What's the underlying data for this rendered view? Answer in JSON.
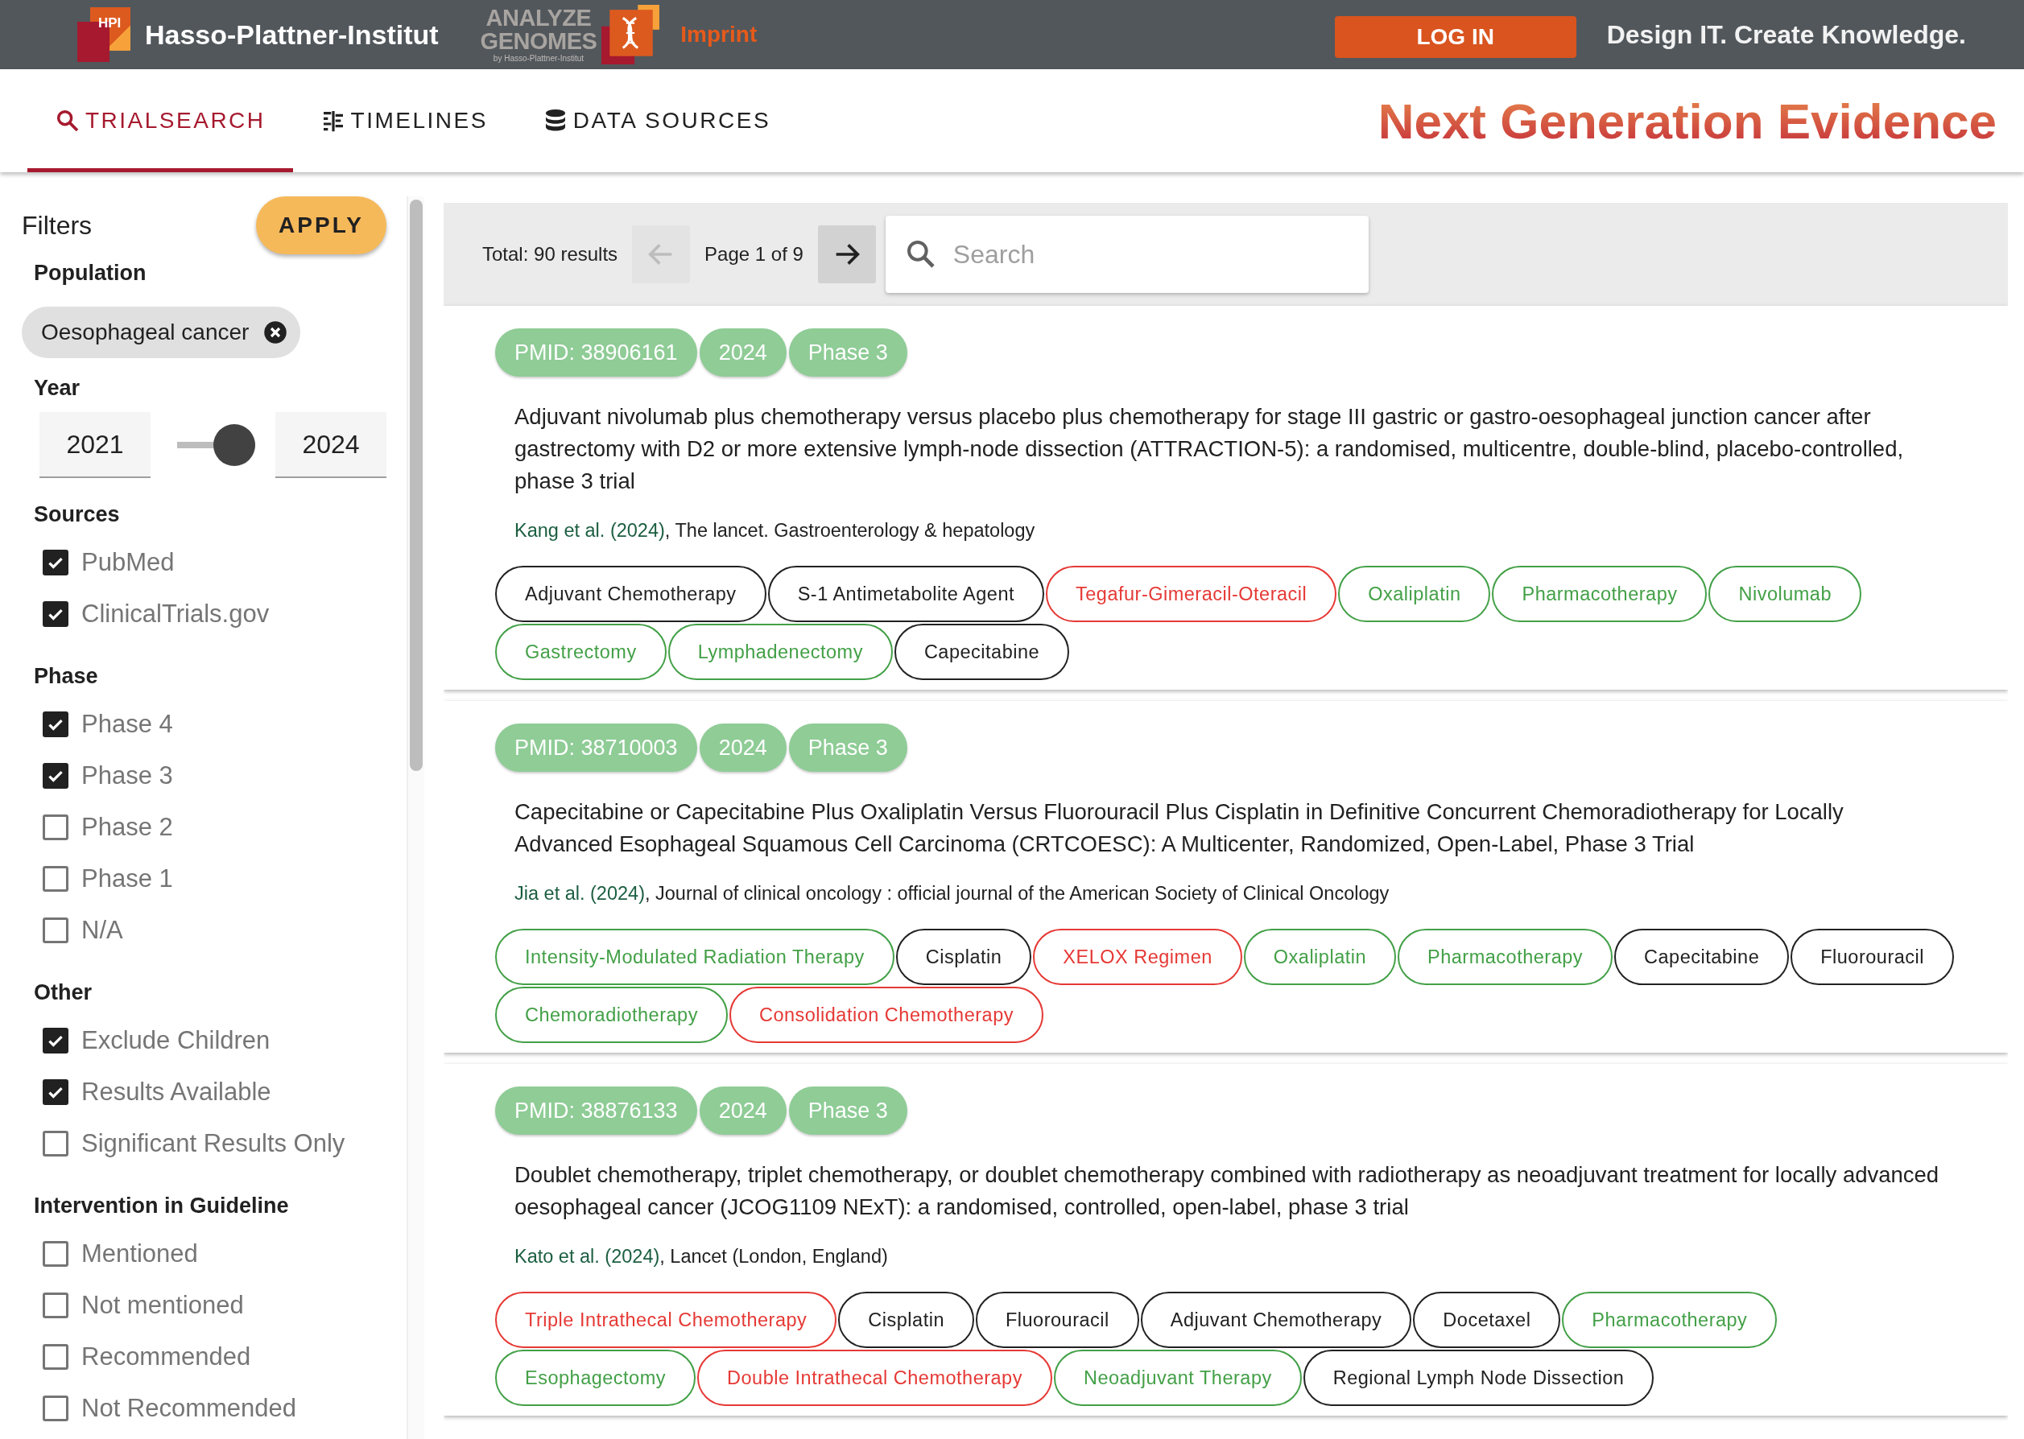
{
  "header": {
    "hpi_logo": "HPI",
    "institute": "Hasso-Plattner-Institut",
    "product_logo": {
      "line1": "ANALYZE",
      "line2": "GENOMES",
      "byline": "by Hasso-Plattner-Institut"
    },
    "imprint": "Imprint",
    "login": "LOG IN",
    "tagline": "Design IT. Create Knowledge."
  },
  "tabs": [
    {
      "label": "TRIALSEARCH",
      "kind": "search",
      "selected": true
    },
    {
      "label": "TIMELINES",
      "kind": "timeline",
      "selected": false
    },
    {
      "label": "DATA SOURCES",
      "kind": "database",
      "selected": false
    }
  ],
  "page_title": "Next Generation Evidence",
  "filters": {
    "title": "Filters",
    "apply": "APPLY",
    "population": {
      "label": "Population",
      "chips": [
        "Oesophageal cancer"
      ]
    },
    "year": {
      "label": "Year",
      "from": "2021",
      "to": "2024",
      "level": 1
    },
    "groups": [
      {
        "label": "Sources",
        "options": [
          {
            "label": "PubMed",
            "checked": true
          },
          {
            "label": "ClinicalTrials.gov",
            "checked": true
          }
        ]
      },
      {
        "label": "Phase",
        "options": [
          {
            "label": "Phase 4",
            "checked": true
          },
          {
            "label": "Phase 3",
            "checked": true
          },
          {
            "label": "Phase 2",
            "checked": false
          },
          {
            "label": "Phase 1",
            "checked": false
          },
          {
            "label": "N/A",
            "checked": false
          }
        ]
      },
      {
        "label": "Other",
        "options": [
          {
            "label": "Exclude Children",
            "checked": true
          },
          {
            "label": "Results Available",
            "checked": true
          },
          {
            "label": "Significant Results Only",
            "checked": false
          }
        ]
      },
      {
        "label": "Intervention in Guideline",
        "options": [
          {
            "label": "Mentioned",
            "checked": false
          },
          {
            "label": "Not mentioned",
            "checked": false
          },
          {
            "label": "Recommended",
            "checked": false
          },
          {
            "label": "Not Recommended",
            "checked": false
          }
        ]
      }
    ]
  },
  "results": {
    "total": "Total: 90 results",
    "prev": {
      "disabled": true
    },
    "page": "Page 1 of 9",
    "next": {
      "disabled": false
    },
    "search_placeholder": "Search",
    "items": [
      {
        "pmid": "PMID: 38906161",
        "year": "2024",
        "phase": "Phase 3",
        "title": "Adjuvant nivolumab plus chemotherapy versus placebo plus chemotherapy for stage III gastric or gastro-oesophageal junction cancer after gastrectomy with D2 or more extensive lymph-node dissection (ATTRACTION-5): a randomised, multicentre, double-blind, placebo-controlled, phase 3 trial",
        "author": "Kang et al. (2024)",
        "journal": ", The lancet. Gastroenterology & hepatology",
        "tags": [
          {
            "label": "Adjuvant Chemotherapy",
            "color": "#212121"
          },
          {
            "label": "S-1 Antimetabolite Agent",
            "color": "#212121"
          },
          {
            "label": "Tegafur-Gimeracil-Oteracil",
            "color": "#e53935"
          },
          {
            "label": "Oxaliplatin",
            "color": "#43a047"
          },
          {
            "label": "Pharmacotherapy",
            "color": "#43a047"
          },
          {
            "label": "Nivolumab",
            "color": "#43a047"
          },
          {
            "label": "Gastrectomy",
            "color": "#43a047"
          },
          {
            "label": "Lymphadenectomy",
            "color": "#43a047"
          },
          {
            "label": "Capecitabine",
            "color": "#212121"
          }
        ]
      },
      {
        "pmid": "PMID: 38710003",
        "year": "2024",
        "phase": "Phase 3",
        "title": "Capecitabine or Capecitabine Plus Oxaliplatin Versus Fluorouracil Plus Cisplatin in Definitive Concurrent Chemoradiotherapy for Locally Advanced Esophageal Squamous Cell Carcinoma (CRTCOESC): A Multicenter, Randomized, Open-Label, Phase 3 Trial",
        "author": "Jia et al. (2024)",
        "journal": ", Journal of clinical oncology : official journal of the American Society of Clinical Oncology",
        "tags": [
          {
            "label": "Intensity-Modulated Radiation Therapy",
            "color": "#43a047"
          },
          {
            "label": "Cisplatin",
            "color": "#212121"
          },
          {
            "label": "XELOX Regimen",
            "color": "#e53935"
          },
          {
            "label": "Oxaliplatin",
            "color": "#43a047"
          },
          {
            "label": "Pharmacotherapy",
            "color": "#43a047"
          },
          {
            "label": "Capecitabine",
            "color": "#212121"
          },
          {
            "label": "Fluorouracil",
            "color": "#212121"
          },
          {
            "label": "Chemoradiotherapy",
            "color": "#43a047"
          },
          {
            "label": "Consolidation Chemotherapy",
            "color": "#e53935"
          }
        ]
      },
      {
        "pmid": "PMID: 38876133",
        "year": "2024",
        "phase": "Phase 3",
        "title": "Doublet chemotherapy, triplet chemotherapy, or doublet chemotherapy combined with radiotherapy as neoadjuvant treatment for locally advanced oesophageal cancer (JCOG1109 NExT): a randomised, controlled, open-label, phase 3 trial",
        "author": "Kato et al. (2024)",
        "journal": ", Lancet (London, England)",
        "tags": [
          {
            "label": "Triple Intrathecal Chemotherapy",
            "color": "#e53935"
          },
          {
            "label": "Cisplatin",
            "color": "#212121"
          },
          {
            "label": "Fluorouracil",
            "color": "#212121"
          },
          {
            "label": "Adjuvant Chemotherapy",
            "color": "#212121"
          },
          {
            "label": "Docetaxel",
            "color": "#212121"
          },
          {
            "label": "Pharmacotherapy",
            "color": "#43a047"
          },
          {
            "label": "Esophagectomy",
            "color": "#43a047"
          },
          {
            "label": "Double Intrathecal Chemotherapy",
            "color": "#e53935"
          },
          {
            "label": "Neoadjuvant Therapy",
            "color": "#43a047"
          },
          {
            "label": "Regional Lymph Node Dissection",
            "color": "#212121"
          }
        ]
      }
    ]
  }
}
